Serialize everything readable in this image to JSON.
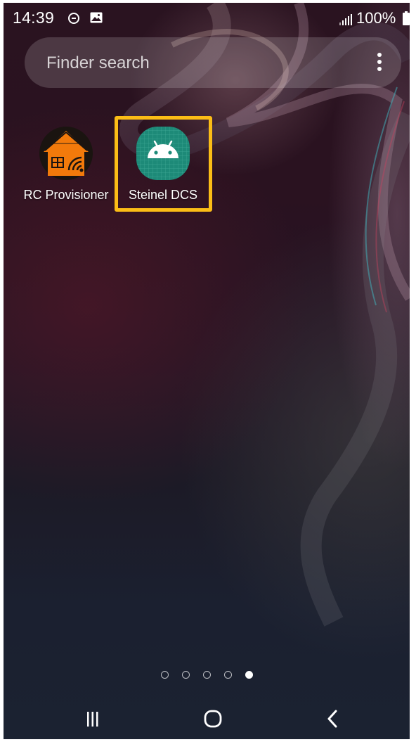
{
  "status_bar": {
    "time": "14:39",
    "battery": "100%",
    "icons": [
      "do-not-disturb-icon",
      "gallery-icon",
      "signal-icon",
      "battery-icon"
    ]
  },
  "search": {
    "placeholder": "Finder search",
    "more_icon": "more-vertical-icon"
  },
  "apps": [
    {
      "label": "RC Provisioner",
      "icon": "house-wifi-icon",
      "color": "#f27a0b"
    },
    {
      "label": "Steinel DCS",
      "icon": "android-icon",
      "color": "#1d8a78",
      "highlighted": true
    }
  ],
  "highlight_color": "#fbbd16",
  "page_indicator": {
    "total": 5,
    "active": 5
  },
  "nav_bar": {
    "buttons": [
      "recents-icon",
      "home-icon",
      "back-icon"
    ]
  }
}
